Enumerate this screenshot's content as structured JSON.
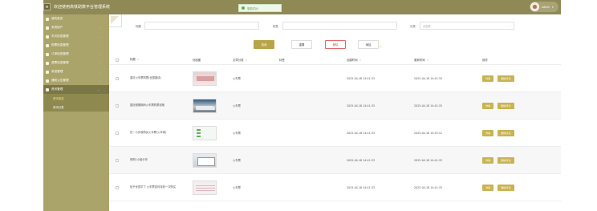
{
  "header": {
    "title": "欢迎使用高铁助数平台管理系统",
    "toast": "登录成功!",
    "user": "admin"
  },
  "sidebar": {
    "items": [
      {
        "label": "我的首页",
        "active": false
      },
      {
        "label": "系统用户",
        "active": false
      },
      {
        "label": "车次信息管理",
        "active": false
      },
      {
        "label": "购票信息管理",
        "active": false
      },
      {
        "label": "订单信息管理",
        "active": false
      },
      {
        "label": "退票信息管理",
        "active": false
      },
      {
        "label": "系统管理",
        "active": false
      },
      {
        "label": "通知公告管理",
        "active": false
      },
      {
        "label": "资讯管理",
        "active": true
      }
    ],
    "subitems": [
      {
        "label": "资讯信息",
        "active": true
      },
      {
        "label": "资讯分类",
        "active": false
      }
    ]
  },
  "filters": {
    "title_label": "标题",
    "title_placeholder": "",
    "tag_label": "标签",
    "tag_placeholder": "",
    "category_label": "分类",
    "category_placeholder": "请选择"
  },
  "actions": {
    "search": "查询",
    "reset": "重置",
    "delete": "删除",
    "add": "添加"
  },
  "table": {
    "headers": {
      "title": "标题",
      "image": "封面图",
      "category": "文章分类",
      "description": "标签",
      "created": "创建时间",
      "updated": "更新时间",
      "ops": "操作"
    },
    "rows": [
      {
        "title": "重庆火车票购票(全国路线)",
        "category": "火车票",
        "description": "",
        "created": "2025-04-18 14:41:33",
        "updated": "2025-04-18 14:41:33"
      },
      {
        "title": "国庆假期期间火车票购票攻略",
        "category": "火车票",
        "description": "",
        "created": "2025-04-18 14:41:33",
        "updated": "2025-04-18 14:41:33"
      },
      {
        "title": "仅一小步就购买火车票(火车网)",
        "category": "火车票",
        "description": "",
        "created": "2025-04-18 14:41:33",
        "updated": "2025-04-18 14:45:12"
      },
      {
        "title": "快购1小组分享",
        "category": "火车票",
        "description": "",
        "created": "2025-04-18 14:41:33",
        "updated": "2025-04-18 14:41:33"
      },
      {
        "title": "给予优惠华丁 火车票如何找到一次购买",
        "category": "火车票",
        "description": "",
        "created": "2025-04-18 14:41:33",
        "updated": "2025-04-18 14:41:33"
      }
    ],
    "op_detail": "详情",
    "op_delete": "删除评论"
  },
  "colors": {
    "sidebar": "#aaa46a",
    "topbar": "#8f8a55",
    "accent": "#b8a548",
    "delete": "#d9534f"
  }
}
